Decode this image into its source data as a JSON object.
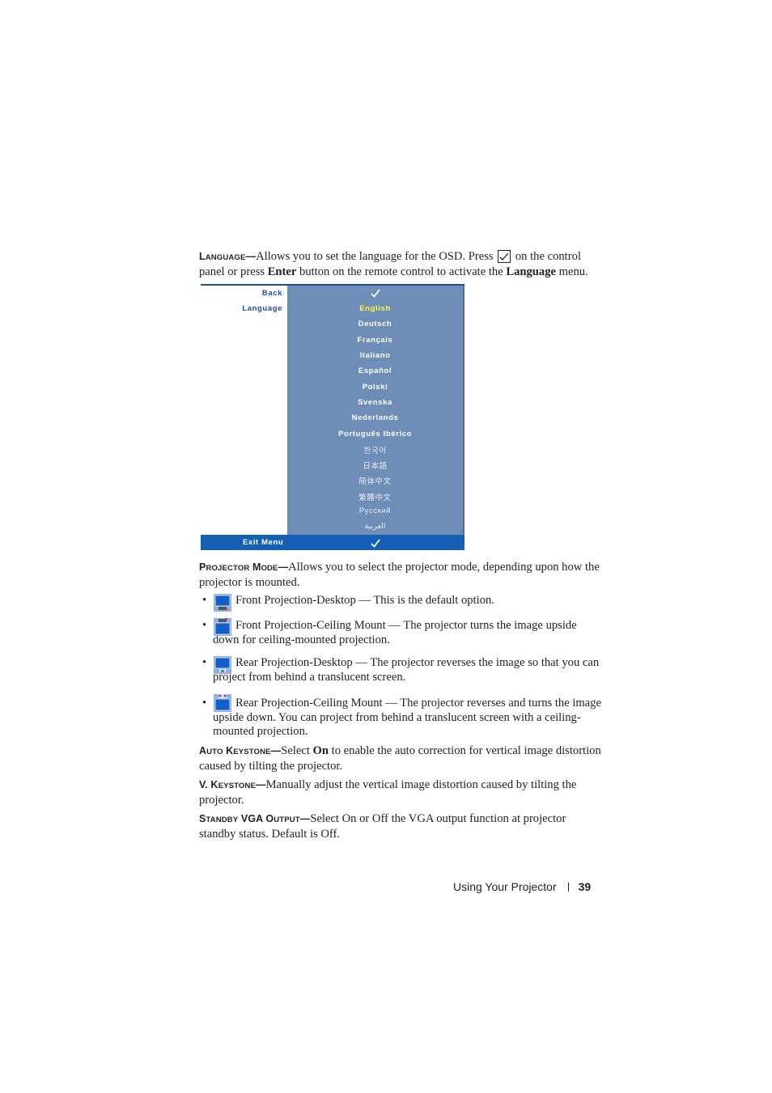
{
  "language_section": {
    "term_first": "L",
    "term_rest": "ANGUAGE",
    "dash": "—",
    "text_1": "Allows you to set the language for the OSD. Press",
    "key_icon": "checkmark-button-icon",
    "text_2": " on the control panel or press ",
    "bold_1": "Enter",
    "text_3": " button on the remote control to activate the ",
    "bold_2": "Language",
    "text_4": " menu."
  },
  "osd_menu": {
    "colors": {
      "panel": "#6e8db7",
      "footer": "#1560b4",
      "left_text": "#1f4e9b",
      "selected": "#ffff33"
    },
    "left_items": [
      {
        "label": "Back"
      },
      {
        "label": "Language"
      }
    ],
    "back_check_icon": "checkmark-icon",
    "languages": [
      {
        "label": "English",
        "selected": true
      },
      {
        "label": "Deutsch"
      },
      {
        "label": "Français"
      },
      {
        "label": "Italiano"
      },
      {
        "label": "Español"
      },
      {
        "label": "Polski"
      },
      {
        "label": "Svenska"
      },
      {
        "label": "Nederlands"
      },
      {
        "label": "Português Ibérico"
      },
      {
        "label": "한국어"
      },
      {
        "label": "日本語"
      },
      {
        "label": "简体中文"
      },
      {
        "label": "繁體中文"
      },
      {
        "label": "Русский"
      },
      {
        "label": "العربية"
      }
    ],
    "exit_label": "Exit Menu",
    "exit_check_icon": "checkmark-icon"
  },
  "projector_mode_section": {
    "term_1_first": "P",
    "term_1_rest": "ROJECTOR",
    "term_2_first": "M",
    "term_2_rest": "ODE",
    "dash": "—",
    "text": "Allows you to select the projector mode, depending upon how the projector is mounted.",
    "options": [
      {
        "icon": "front-projection-desktop-icon",
        "text": "Front Projection-Desktop — This is the default option."
      },
      {
        "icon": "front-projection-ceiling-icon",
        "text": "Front Projection-Ceiling Mount — The projector turns the image upside down for ceiling-mounted projection."
      },
      {
        "icon": "rear-projection-desktop-icon",
        "text": "Rear Projection-Desktop — The projector reverses the image so that you can project from behind a translucent screen."
      },
      {
        "icon": "rear-projection-ceiling-icon",
        "text": "Rear Projection-Ceiling Mount — The projector reverses and turns the image upside down. You can project from behind a translucent screen with a ceiling-mounted projection."
      }
    ]
  },
  "auto_keystone_section": {
    "term_1_first": "A",
    "term_1_rest": "UTO",
    "term_2_first": "K",
    "term_2_rest": "EYSTONE",
    "dash": "—",
    "text_1": "Select ",
    "bold": "On",
    "text_2": " to enable the auto correction for vertical image distortion caused by tilting the projector."
  },
  "v_keystone_section": {
    "term_prefix": "V. K",
    "term_rest": "EYSTONE",
    "dash": "—",
    "text": "Manually adjust the vertical image distortion caused by tilting the projector."
  },
  "standby_vga_section": {
    "term_1_first": "S",
    "term_1_rest": "TANDBY",
    "term_2": "VGA",
    "term_3_first": "O",
    "term_3_rest": "UTPUT",
    "dash": "—",
    "text": "Select On or Off the VGA output function at projector standby status. Default is Off."
  },
  "page_footer": {
    "section_title": "Using Your Projector",
    "page_number": "39"
  }
}
